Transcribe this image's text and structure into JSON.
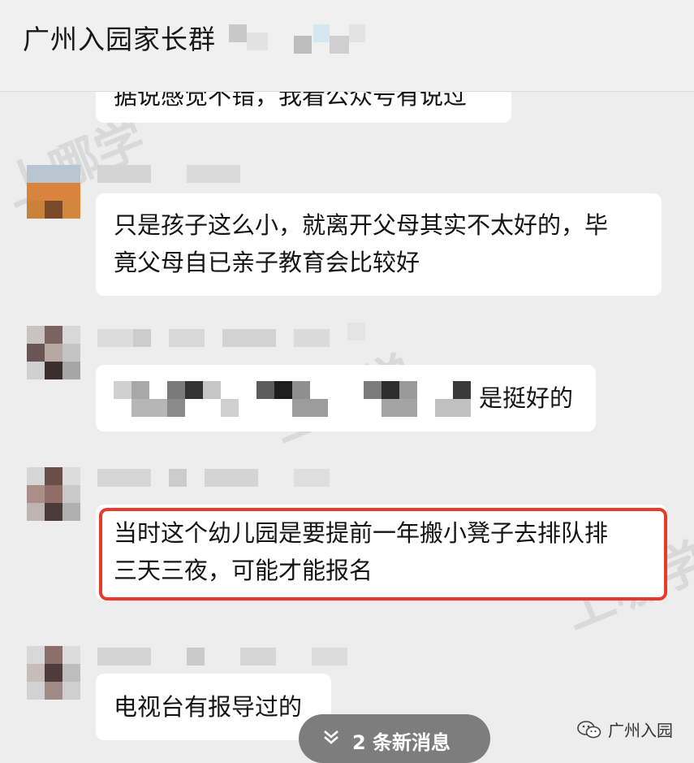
{
  "header": {
    "title": "广州入园家长群"
  },
  "messages": [
    {
      "text_lines": [
        "据说感觉不错，我看公众号有说过"
      ]
    },
    {
      "text_lines": [
        "只是孩子这么小，就离开父母其实不太好的，毕",
        "竟父母自已亲子教育会比较好"
      ]
    },
    {
      "text_lines": [
        "是挺好的"
      ]
    },
    {
      "text_lines": [
        "当时这个幼儿园是要提前一年搬小凳子去排队排",
        "三天三夜，可能才能报名"
      ],
      "highlighted": true
    },
    {
      "text_lines": [
        "电视台有报导过的"
      ]
    }
  ],
  "new_messages_pill": {
    "label": "2 条新消息"
  },
  "watermark": {
    "brand": "上哪学",
    "corner_label": "广州入园"
  },
  "colors": {
    "highlight_border": "#e8392c",
    "bubble": "#ffffff",
    "background": "#ededed"
  }
}
